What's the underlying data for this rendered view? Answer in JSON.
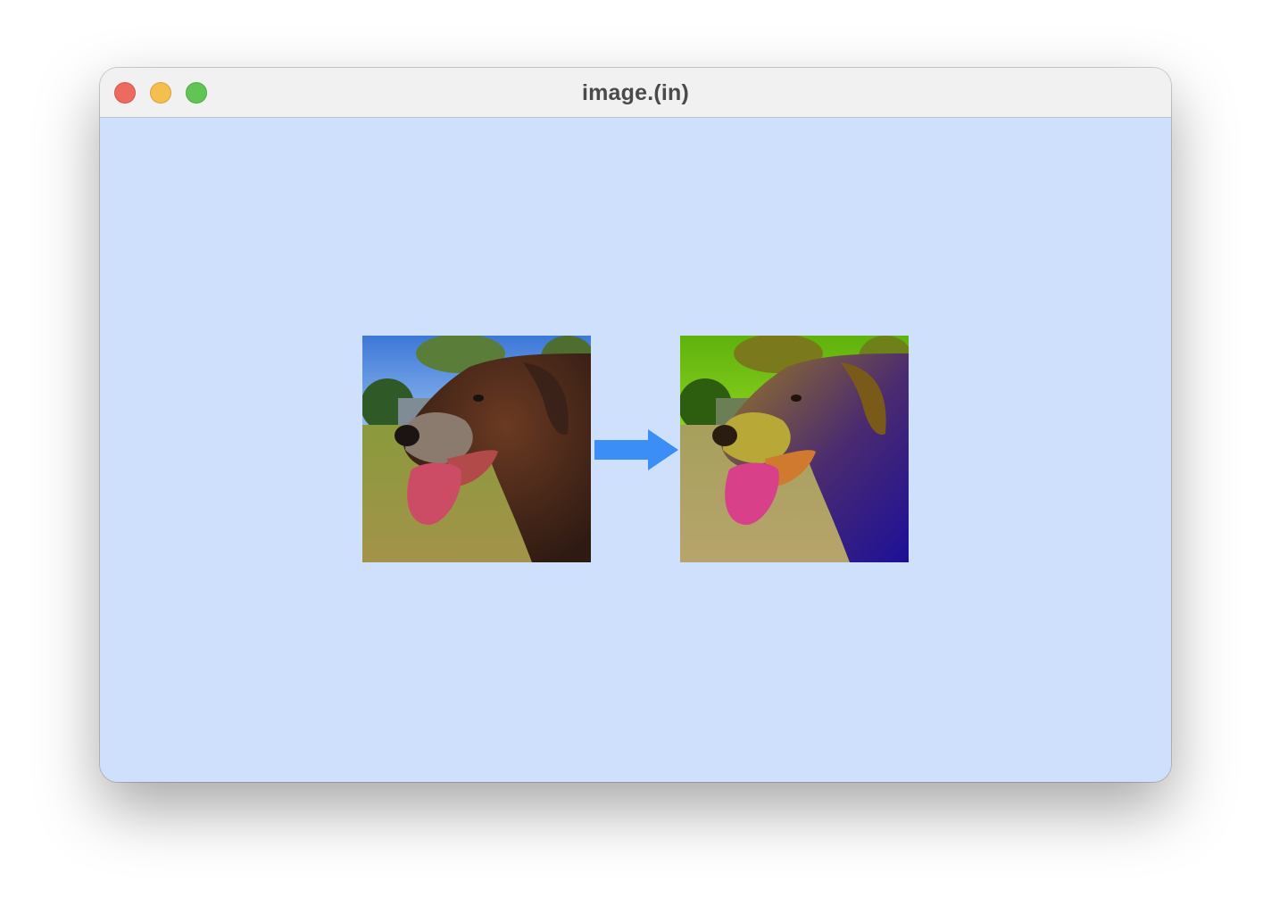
{
  "window": {
    "title": "image.(in)",
    "controls": [
      "close",
      "minimize",
      "zoom"
    ]
  },
  "colors": {
    "content_background": "#cfe0fc",
    "arrow": "#3a8ef6",
    "titlebar": "#f1f1f1"
  },
  "content": {
    "input_image": {
      "icon": "dog-photo-original"
    },
    "arrow": {
      "icon": "right-arrow-icon"
    },
    "output_image": {
      "icon": "dog-photo-color-shifted"
    }
  }
}
